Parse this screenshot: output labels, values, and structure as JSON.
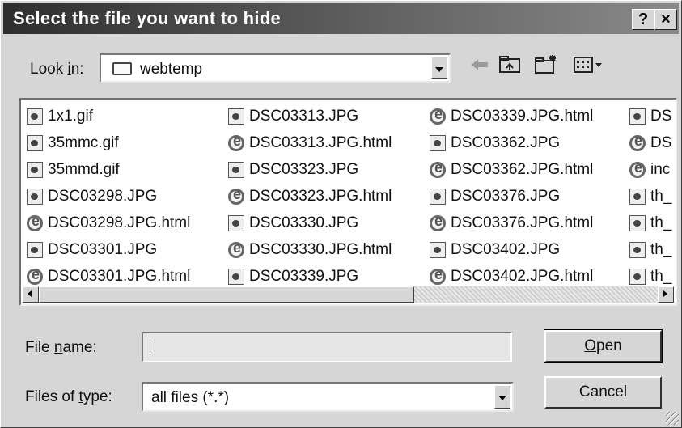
{
  "window": {
    "title": "Select the file you want to hide"
  },
  "titlebar": {
    "help_label": "?",
    "close_label": "×"
  },
  "toolbar": {
    "look_in_label_prefix": "Look ",
    "look_in_label_accel": "i",
    "look_in_label_suffix": "n:",
    "folder": "webtemp",
    "icons": [
      "back-arrow-icon",
      "up-folder-icon",
      "new-folder-icon",
      "view-menu-icon"
    ]
  },
  "files": {
    "columns": [
      [
        {
          "name": "1x1.gif",
          "type": "img"
        },
        {
          "name": "35mmc.gif",
          "type": "img"
        },
        {
          "name": "35mmd.gif",
          "type": "img"
        },
        {
          "name": "DSC03298.JPG",
          "type": "img"
        },
        {
          "name": "DSC03298.JPG.html",
          "type": "html"
        },
        {
          "name": "DSC03301.JPG",
          "type": "img"
        },
        {
          "name": "DSC03301.JPG.html",
          "type": "html"
        }
      ],
      [
        {
          "name": "DSC03313.JPG",
          "type": "img"
        },
        {
          "name": "DSC03313.JPG.html",
          "type": "html"
        },
        {
          "name": "DSC03323.JPG",
          "type": "img"
        },
        {
          "name": "DSC03323.JPG.html",
          "type": "html"
        },
        {
          "name": "DSC03330.JPG",
          "type": "img"
        },
        {
          "name": "DSC03330.JPG.html",
          "type": "html"
        },
        {
          "name": "DSC03339.JPG",
          "type": "img"
        }
      ],
      [
        {
          "name": "DSC03339.JPG.html",
          "type": "html"
        },
        {
          "name": "DSC03362.JPG",
          "type": "img"
        },
        {
          "name": "DSC03362.JPG.html",
          "type": "html"
        },
        {
          "name": "DSC03376.JPG",
          "type": "img"
        },
        {
          "name": "DSC03376.JPG.html",
          "type": "html"
        },
        {
          "name": "DSC03402.JPG",
          "type": "img"
        },
        {
          "name": "DSC03402.JPG.html",
          "type": "html"
        }
      ],
      [
        {
          "name": "DS",
          "type": "img"
        },
        {
          "name": "DS",
          "type": "html"
        },
        {
          "name": "inc",
          "type": "html"
        },
        {
          "name": "th_",
          "type": "img"
        },
        {
          "name": "th_",
          "type": "img"
        },
        {
          "name": "th_",
          "type": "img"
        },
        {
          "name": "th_",
          "type": "img"
        }
      ]
    ]
  },
  "form": {
    "file_name_label_prefix": "File ",
    "file_name_label_accel": "n",
    "file_name_label_suffix": "ame:",
    "file_name_value": "",
    "file_type_label_prefix": "Files of ",
    "file_type_label_accel": "t",
    "file_type_label_suffix": "ype:",
    "file_type_value": "all files (*.*)"
  },
  "buttons": {
    "open_accel": "O",
    "open_rest": "pen",
    "cancel": "Cancel"
  }
}
